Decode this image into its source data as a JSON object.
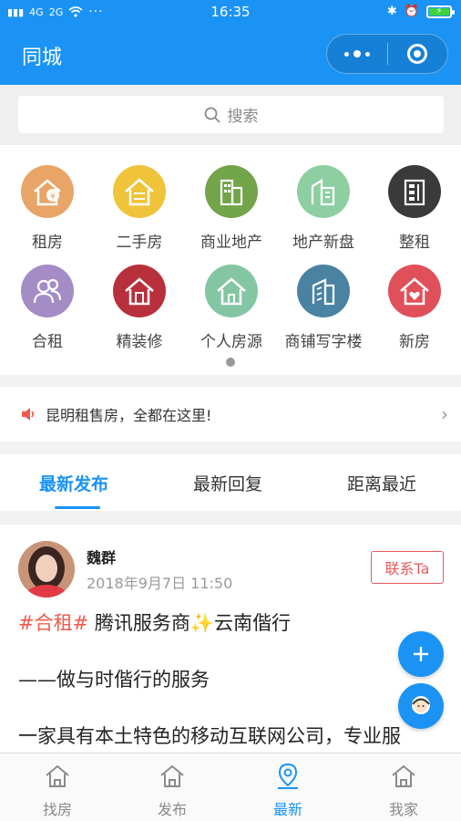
{
  "status_bar": {
    "signal_left": "4G",
    "signal_right": "2G",
    "dots": "···",
    "time": "16:35"
  },
  "header": {
    "title": "同城",
    "color": "#1a93f5"
  },
  "search": {
    "placeholder": "搜索"
  },
  "categories": [
    {
      "label": "租房",
      "icon": "rent-house-icon",
      "color": "#e8a567"
    },
    {
      "label": "二手房",
      "icon": "second-hand-house-icon",
      "color": "#f0c43a"
    },
    {
      "label": "商业地产",
      "icon": "commercial-building-icon",
      "color": "#72a44a"
    },
    {
      "label": "地产新盘",
      "icon": "new-building-icon",
      "color": "#8ecfa2"
    },
    {
      "label": "整租",
      "icon": "whole-rent-icon",
      "color": "#3a3a3a"
    },
    {
      "label": "合租",
      "icon": "shared-rent-icon",
      "color": "#a48cc6"
    },
    {
      "label": "精装修",
      "icon": "decoration-icon",
      "color": "#b8303c"
    },
    {
      "label": "个人房源",
      "icon": "personal-listing-icon",
      "color": "#84c6a4"
    },
    {
      "label": "商铺写字楼",
      "icon": "office-building-icon",
      "color": "#4a82a2"
    },
    {
      "label": "新房",
      "icon": "new-house-icon",
      "color": "#e0505a"
    }
  ],
  "notice": {
    "text": "昆明租售房，全都在这里!"
  },
  "tabs": [
    {
      "label": "最新发布",
      "active": true
    },
    {
      "label": "最新回复",
      "active": false
    },
    {
      "label": "距离最近",
      "active": false
    }
  ],
  "post": {
    "author": "魏群",
    "time": "2018年9月7日 11:50",
    "contact_label": "联系Ta",
    "hashtag": "#合租#",
    "line1_rest": " 腾讯服务商✨云南偕行",
    "line2": "——做与时偕行的服务",
    "line3": "一家具有本土特色的移动互联网公司，专业服"
  },
  "tabbar": [
    {
      "label": "找房",
      "icon": "house-icon",
      "active": false
    },
    {
      "label": "发布",
      "icon": "house-icon",
      "active": false
    },
    {
      "label": "最新",
      "icon": "location-pin-icon",
      "active": true
    },
    {
      "label": "我家",
      "icon": "house-icon",
      "active": false
    }
  ]
}
